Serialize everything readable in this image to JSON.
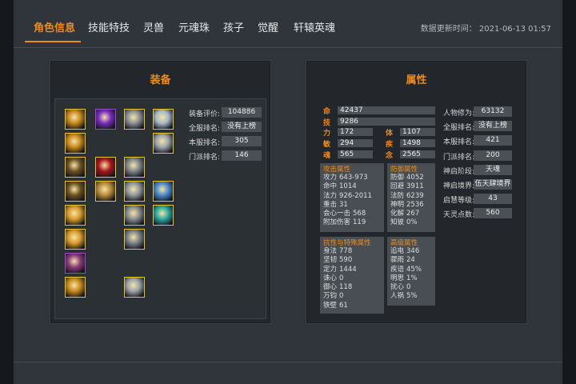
{
  "tabs": [
    {
      "label": "角色信息",
      "active": true
    },
    {
      "label": "技能特技"
    },
    {
      "label": "灵兽"
    },
    {
      "label": "元魂珠"
    },
    {
      "label": "孩子"
    },
    {
      "label": "觉醒"
    },
    {
      "label": "轩辕英魂"
    }
  ],
  "update_time": "数据更新时间： 2021-06-13 01:57",
  "equip": {
    "title": "装备",
    "stats": [
      {
        "label": "装备评价:",
        "value": "104886"
      },
      {
        "label": "全服排名:",
        "value": "没有上榜"
      },
      {
        "label": "本服排名:",
        "value": "305"
      },
      {
        "label": "门派排名:",
        "value": "146"
      }
    ],
    "slots": [
      {
        "icon": "gold-gear-icon",
        "color": "#c8881a"
      },
      {
        "icon": "purple-orb-icon",
        "color": "#7a2bbf",
        "rarity": "purple"
      },
      {
        "icon": "dagger-icon",
        "color": "#8a8f95"
      },
      {
        "icon": "silver-wing-icon",
        "color": "#a9b8c8"
      },
      {
        "icon": "gold-scroll-icon",
        "color": "#c8881a"
      },
      {
        "icon": "silver-boot-icon",
        "color": "#9ba2aa"
      },
      {
        "icon": "dark-ring-icon",
        "color": "#6a5020"
      },
      {
        "icon": "red-flame-icon",
        "color": "#a8141a"
      },
      {
        "icon": "gray-armor-icon",
        "color": "#7e848a"
      },
      {
        "icon": "bronze-ring-icon",
        "color": "#6a5020"
      },
      {
        "icon": "gold-hand-icon",
        "color": "#b88a38"
      },
      {
        "icon": "steel-armor-icon",
        "color": "#8e959c"
      },
      {
        "icon": "blue-blade-icon",
        "color": "#4a88c8"
      },
      {
        "icon": "sapphire-ring-icon",
        "color": "#d89a2a"
      },
      {
        "icon": "gray-leggings-icon",
        "color": "#858b91"
      },
      {
        "icon": "teal-crystal-icon",
        "color": "#2aa8a0"
      },
      {
        "icon": "gold-ring-icon",
        "color": "#d89a2a"
      },
      {
        "icon": "gray-trousers-icon",
        "color": "#7b8187"
      },
      {
        "icon": "gold-necklace-icon",
        "color": "#8a3a7a",
        "rarity": "purple"
      },
      {
        "icon": "gold-bracelet-icon",
        "color": "#c8881a"
      },
      {
        "icon": "silver-shoe-icon",
        "color": "#9aa1a8"
      }
    ]
  },
  "attr": {
    "title": "属性",
    "main": [
      {
        "label": "命",
        "value": "42437"
      },
      {
        "label": "技",
        "value": "9286"
      }
    ],
    "pairs": [
      [
        {
          "label": "力",
          "value": "172"
        },
        {
          "label": "体",
          "value": "1107"
        }
      ],
      [
        {
          "label": "敏",
          "value": "294"
        },
        {
          "label": "疾",
          "value": "1498"
        }
      ],
      [
        {
          "label": "魂",
          "value": "565"
        },
        {
          "label": "念",
          "value": "2565"
        }
      ]
    ],
    "boxes": [
      {
        "title": "攻击属性",
        "rows": [
          {
            "label": "攻力",
            "value": "643-973"
          },
          {
            "label": "命中",
            "value": "1014"
          },
          {
            "label": "法力",
            "value": "926-2011"
          },
          {
            "label": "重击",
            "value": "31"
          },
          {
            "label": "会心一击",
            "value": "568"
          },
          {
            "label": "附加伤害",
            "value": "119"
          }
        ]
      },
      {
        "title": "防御属性",
        "rows": [
          {
            "label": "防御",
            "value": "4052"
          },
          {
            "label": "回避",
            "value": "3911"
          },
          {
            "label": "法防",
            "value": "6239"
          },
          {
            "label": "神明",
            "value": "2536"
          },
          {
            "label": "化解",
            "value": "267"
          },
          {
            "label": "知彼",
            "value": "0%"
          }
        ]
      },
      {
        "title": "抗性与特殊属性",
        "rows": [
          {
            "label": "身法",
            "value": "778"
          },
          {
            "label": "坚韧",
            "value": "590"
          },
          {
            "label": "定力",
            "value": "1444"
          },
          {
            "label": "诛心",
            "value": "0"
          },
          {
            "label": "御心",
            "value": "118"
          },
          {
            "label": "万钧",
            "value": "0"
          },
          {
            "label": "铁壁",
            "value": "61"
          }
        ]
      },
      {
        "title": "高级属性",
        "rows": [
          {
            "label": "追电",
            "value": "346"
          },
          {
            "label": "骤雨",
            "value": "24"
          },
          {
            "label": "疾语",
            "value": "45%"
          },
          {
            "label": "明思",
            "value": "1%"
          },
          {
            "label": "扰心",
            "value": "0"
          },
          {
            "label": "人祸",
            "value": "5%"
          }
        ]
      }
    ],
    "side": [
      {
        "label": "人物修为:",
        "value": "63132"
      },
      {
        "label": "全服排名:",
        "value": "没有上榜"
      },
      {
        "label": "本服排名:",
        "value": "421"
      },
      {
        "label": "门派排名:",
        "value": "200"
      },
      {
        "label": "神启阶段:",
        "value": "天魂"
      },
      {
        "label": "神启境界:",
        "value": "伍天肆境界"
      },
      {
        "label": "启慧等级:",
        "value": "43"
      },
      {
        "label": "天灵点数:",
        "value": "560"
      }
    ]
  }
}
